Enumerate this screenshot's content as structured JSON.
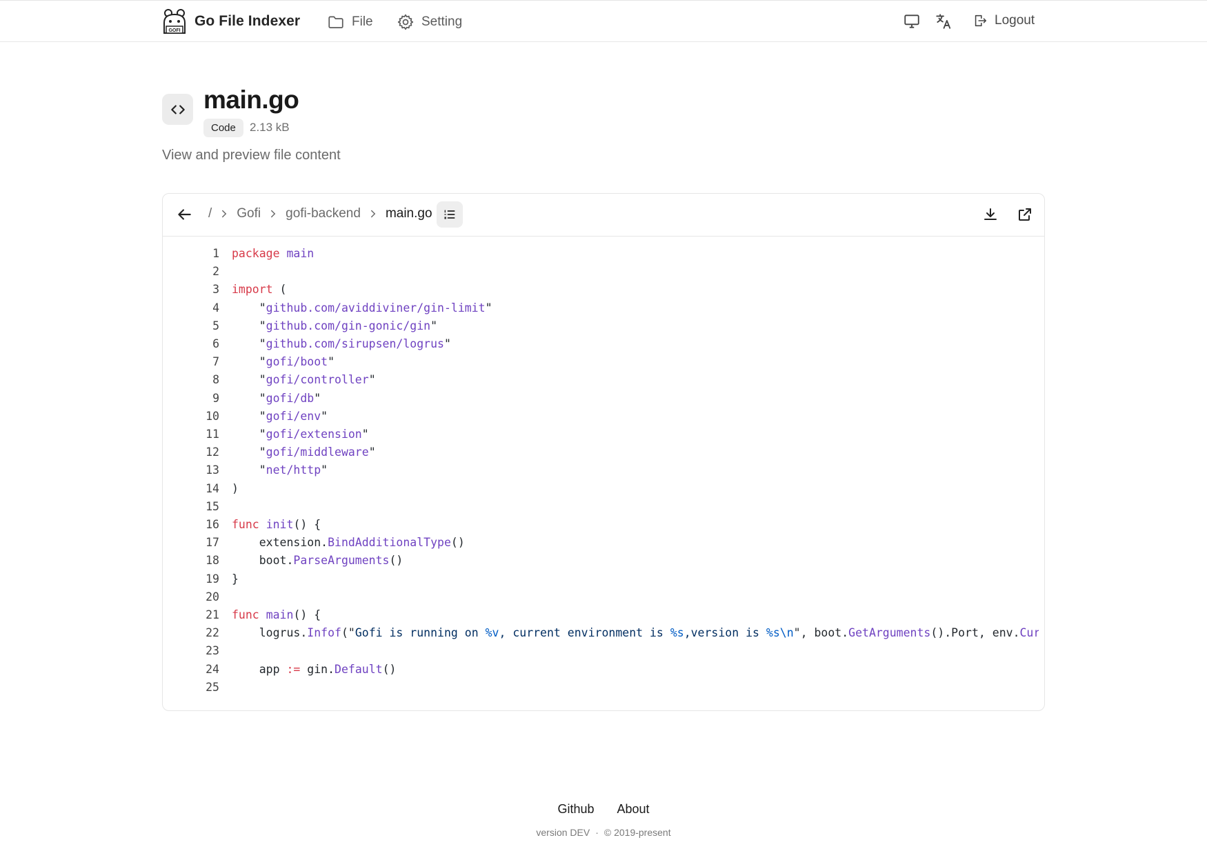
{
  "app": {
    "name": "Go File Indexer",
    "logo_text": "GOFI"
  },
  "nav": {
    "file_label": "File",
    "setting_label": "Setting",
    "logout_label": "Logout"
  },
  "file": {
    "name": "main.go",
    "type_badge": "Code",
    "size": "2.13 kB",
    "subtitle": "View and preview file content"
  },
  "breadcrumb": {
    "root": "/",
    "items": [
      "Gofi",
      "gofi-backend",
      "main.go"
    ]
  },
  "code": {
    "line_numbers": [
      "1",
      "2",
      "3",
      "4",
      "5",
      "6",
      "7",
      "8",
      "9",
      "10",
      "11",
      "12",
      "13",
      "14",
      "15",
      "16",
      "17",
      "18",
      "19",
      "20",
      "21",
      "22",
      "23",
      "24",
      "25"
    ],
    "lines": [
      [
        {
          "t": "package",
          "c": "kw"
        },
        {
          "t": " ",
          "c": "ident"
        },
        {
          "t": "main",
          "c": "fn"
        }
      ],
      [],
      [
        {
          "t": "import",
          "c": "kw"
        },
        {
          "t": " (",
          "c": "ident"
        }
      ],
      [
        {
          "t": "    \"",
          "c": "ident"
        },
        {
          "t": "github.com/aviddiviner/gin-limit",
          "c": "fn"
        },
        {
          "t": "\"",
          "c": "ident"
        }
      ],
      [
        {
          "t": "    \"",
          "c": "ident"
        },
        {
          "t": "github.com/gin-gonic/gin",
          "c": "fn"
        },
        {
          "t": "\"",
          "c": "ident"
        }
      ],
      [
        {
          "t": "    \"",
          "c": "ident"
        },
        {
          "t": "github.com/sirupsen/logrus",
          "c": "fn"
        },
        {
          "t": "\"",
          "c": "ident"
        }
      ],
      [
        {
          "t": "    \"",
          "c": "ident"
        },
        {
          "t": "gofi/boot",
          "c": "fn"
        },
        {
          "t": "\"",
          "c": "ident"
        }
      ],
      [
        {
          "t": "    \"",
          "c": "ident"
        },
        {
          "t": "gofi/controller",
          "c": "fn"
        },
        {
          "t": "\"",
          "c": "ident"
        }
      ],
      [
        {
          "t": "    \"",
          "c": "ident"
        },
        {
          "t": "gofi/db",
          "c": "fn"
        },
        {
          "t": "\"",
          "c": "ident"
        }
      ],
      [
        {
          "t": "    \"",
          "c": "ident"
        },
        {
          "t": "gofi/env",
          "c": "fn"
        },
        {
          "t": "\"",
          "c": "ident"
        }
      ],
      [
        {
          "t": "    \"",
          "c": "ident"
        },
        {
          "t": "gofi/extension",
          "c": "fn"
        },
        {
          "t": "\"",
          "c": "ident"
        }
      ],
      [
        {
          "t": "    \"",
          "c": "ident"
        },
        {
          "t": "gofi/middleware",
          "c": "fn"
        },
        {
          "t": "\"",
          "c": "ident"
        }
      ],
      [
        {
          "t": "    \"",
          "c": "ident"
        },
        {
          "t": "net/http",
          "c": "fn"
        },
        {
          "t": "\"",
          "c": "ident"
        }
      ],
      [
        {
          "t": ")",
          "c": "ident"
        }
      ],
      [],
      [
        {
          "t": "func",
          "c": "kw"
        },
        {
          "t": " ",
          "c": "ident"
        },
        {
          "t": "init",
          "c": "fn"
        },
        {
          "t": "() {",
          "c": "ident"
        }
      ],
      [
        {
          "t": "    extension.",
          "c": "ident"
        },
        {
          "t": "BindAdditionalType",
          "c": "fn"
        },
        {
          "t": "()",
          "c": "ident"
        }
      ],
      [
        {
          "t": "    boot.",
          "c": "ident"
        },
        {
          "t": "ParseArguments",
          "c": "fn"
        },
        {
          "t": "()",
          "c": "ident"
        }
      ],
      [
        {
          "t": "}",
          "c": "ident"
        }
      ],
      [],
      [
        {
          "t": "func",
          "c": "kw"
        },
        {
          "t": " ",
          "c": "ident"
        },
        {
          "t": "main",
          "c": "fn"
        },
        {
          "t": "() {",
          "c": "ident"
        }
      ],
      [
        {
          "t": "    logrus.",
          "c": "ident"
        },
        {
          "t": "Infof",
          "c": "fn"
        },
        {
          "t": "(\"",
          "c": "ident"
        },
        {
          "t": "Gofi is running on ",
          "c": "str"
        },
        {
          "t": "%v",
          "c": "fmt"
        },
        {
          "t": ", current environment is ",
          "c": "str"
        },
        {
          "t": "%s",
          "c": "fmt"
        },
        {
          "t": ",version is ",
          "c": "str"
        },
        {
          "t": "%s\\n",
          "c": "fmt"
        },
        {
          "t": "\", boot.",
          "c": "ident"
        },
        {
          "t": "GetArguments",
          "c": "fn"
        },
        {
          "t": "().Port, env.",
          "c": "ident"
        },
        {
          "t": "Current",
          "c": "fn"
        }
      ],
      [],
      [
        {
          "t": "    app ",
          "c": "ident"
        },
        {
          "t": ":=",
          "c": "kw"
        },
        {
          "t": " gin.",
          "c": "ident"
        },
        {
          "t": "Default",
          "c": "fn"
        },
        {
          "t": "()",
          "c": "ident"
        }
      ],
      []
    ]
  },
  "footer": {
    "links": [
      "Github",
      "About"
    ],
    "version": "version DEV",
    "separator": "·",
    "copyright": "© 2019-present"
  },
  "icons": {
    "logo": "gofi-logo-icon",
    "file": "folder-icon",
    "setting": "gear-icon",
    "monitor": "monitor-icon",
    "translate": "translate-icon",
    "logout": "logout-icon",
    "code": "code-icon",
    "back": "arrow-left-icon",
    "chevron": "chevron-right-icon",
    "toc": "list-icon",
    "download": "download-icon",
    "external": "external-link-icon"
  },
  "colors": {
    "keyword": "#d73a49",
    "string": "#032f62",
    "function": "#6f42c1",
    "format_verb": "#005cc5"
  }
}
